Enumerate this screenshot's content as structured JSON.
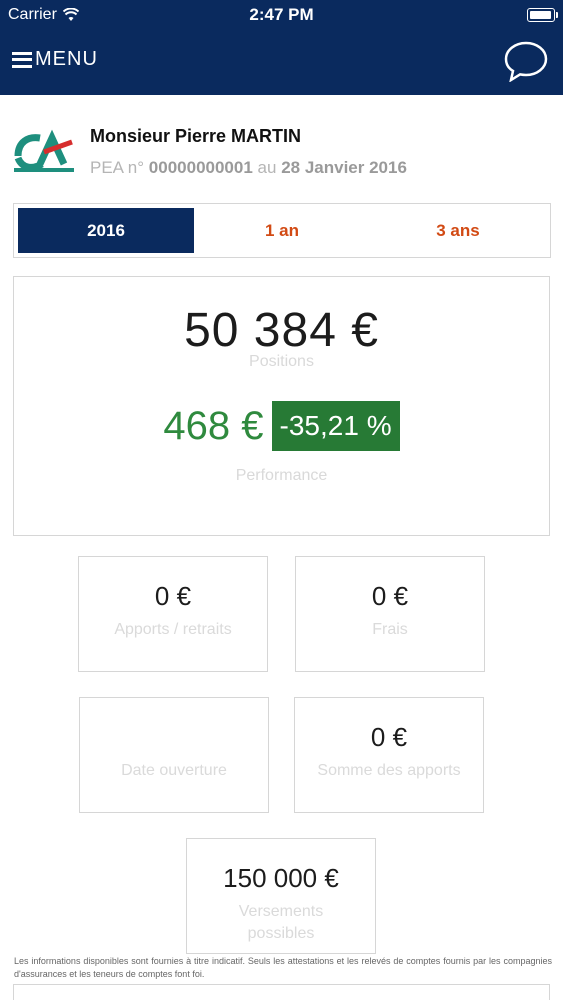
{
  "status_bar": {
    "carrier": "Carrier",
    "time": "2:47 PM",
    "battery_level": 1.0
  },
  "header": {
    "menu_label": "MENU",
    "icons": {
      "menu": "hamburger-icon",
      "chat": "chat-bubble-icon"
    }
  },
  "account": {
    "owner": "Monsieur Pierre MARTIN",
    "line_prefix": "PEA n°",
    "account_number": "00000000001",
    "line_middle": "au",
    "date": "28 Janvier 2016",
    "logo": "credit-agricole-logo"
  },
  "tabs": [
    {
      "label": "2016",
      "active": true
    },
    {
      "label": "1 an",
      "active": false
    },
    {
      "label": "3 ans",
      "active": false
    }
  ],
  "summary": {
    "positions_value": "50 384 €",
    "positions_label": "Positions",
    "performance_value": "468 €",
    "performance_pct": "-35,21 %",
    "performance_label": "Performance"
  },
  "stats": [
    {
      "value": "0 €",
      "label": "Apports / retraits"
    },
    {
      "value": "0 €",
      "label": "Frais"
    },
    {
      "value": "",
      "label": "Date ouverture"
    },
    {
      "value": "0 €",
      "label": "Somme des apports"
    },
    {
      "value": "150 000 €",
      "label": "Versements possibles"
    }
  ],
  "disclaimer": "Les informations disponibles sont fournies à titre indicatif. Seuls les attestations et les relevés de comptes fournis par les compagnies d'assurances et les teneurs de comptes font foi.",
  "colors": {
    "navy": "#0a2a5e",
    "accent_orange": "#d24a14",
    "performance_green": "#277a35"
  }
}
